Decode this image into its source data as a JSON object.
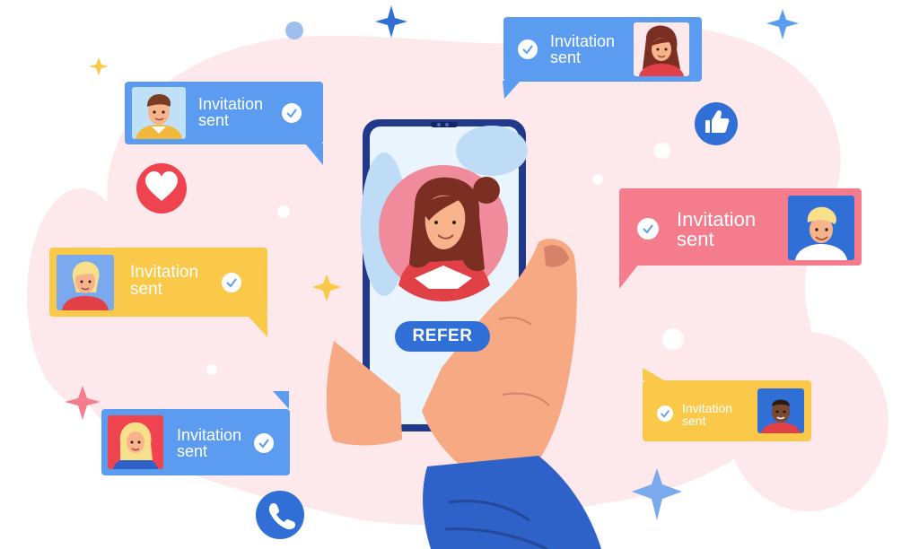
{
  "colors": {
    "blob": "#fde8ec",
    "blue": "#5b9cf0",
    "deep_blue": "#2f6fd6",
    "pink": "#f47c8c",
    "yellow": "#fbc94a",
    "red": "#ef4350",
    "skin": "#f6a982",
    "sleeve": "#2f62c8"
  },
  "bubbles": [
    {
      "color": "blue",
      "line1": "Invitation",
      "line2": "sent"
    },
    {
      "color": "blue",
      "line1": "Invitation",
      "line2": "sent"
    },
    {
      "color": "yellow",
      "line1": "Invitation",
      "line2": "sent"
    },
    {
      "color": "pink",
      "line1": "Invitation",
      "line2": "sent"
    },
    {
      "color": "yellow",
      "line1": "Invitation",
      "line2": "sent"
    },
    {
      "color": "blue",
      "line1": "Invitation",
      "line2": "sent"
    }
  ],
  "phone": {
    "button_label": "REFER"
  },
  "icons": [
    "heart-icon",
    "thumbs-up-icon",
    "phone-call-icon",
    "check-icon",
    "star-icon"
  ]
}
